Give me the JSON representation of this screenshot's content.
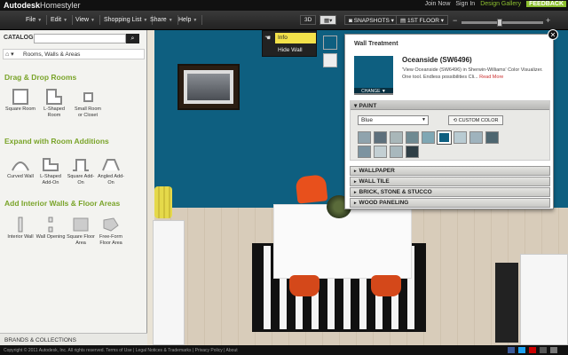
{
  "topbar": {
    "brand": "Autodesk",
    "product": "Homestyler",
    "links": [
      "Join Now",
      "Sign In",
      "Design Gallery"
    ],
    "feedback": "FEEDBACK"
  },
  "menu": {
    "items": [
      "File",
      "Edit",
      "View",
      "Shopping List",
      "Share",
      "Help"
    ],
    "view_3d": "3D",
    "snapshots": "SNAPSHOTS",
    "floor": "1ST FLOOR",
    "zoom_minus": "−",
    "zoom_plus": "+"
  },
  "sidebar": {
    "catalog_label": "CATALOG",
    "search_button": "⌕",
    "breadcrumb": "Rooms, Walls & Areas",
    "sections": [
      {
        "title": "Drag & Drop Rooms",
        "items": [
          "Square Room",
          "L-Shaped Room",
          "Small Room or Closet"
        ]
      },
      {
        "title": "Expand with Room Additions",
        "items": [
          "Curved Wall",
          "L-Shaped Add-On",
          "Square Add-On",
          "Angled Add-On"
        ]
      },
      {
        "title": "Add Interior Walls & Floor Areas",
        "items": [
          "Interior Wall",
          "Wall Opening",
          "Square Floor Area",
          "Free-Form Floor Area"
        ]
      }
    ],
    "footer": "BRANDS & COLLECTIONS"
  },
  "context_menu": {
    "items": [
      "Info",
      "Hide Wall"
    ],
    "selected": "Info"
  },
  "panel": {
    "title": "Wall Treatment",
    "color_name": "Oceanside (SW6496)",
    "description": "'View Oceanside (SW6496) in Sherwin-Williams' Color Visualizer. One tool. Endless possibilities Cli...",
    "read_more": "Read More",
    "change": "CHANGE ▼",
    "paint_header": "PAINT",
    "color_family": "Blue",
    "custom_color": "⟲ CUSTOM COLOR",
    "swatches": [
      "#8fa3ad",
      "#5e707c",
      "#a9b7b9",
      "#6f8a92",
      "#7fa7b4",
      "#0e5f80",
      "#b9cbd2",
      "#9fb3bd",
      "#4e6670",
      "#7c93a0",
      "#c3cfd3",
      "#a8b8bd",
      "#2f3f46"
    ],
    "selected_swatch": 5,
    "sections": [
      "WALLPAPER",
      "WALL TILE",
      "BRICK, STONE & STUCCO",
      "WOOD PANELING"
    ]
  },
  "footer": {
    "copyright": "Copyright © 2011 Autodesk, Inc. All rights reserved. Terms of Use | Legal Notices & Trademarks | Privacy Policy | About"
  }
}
